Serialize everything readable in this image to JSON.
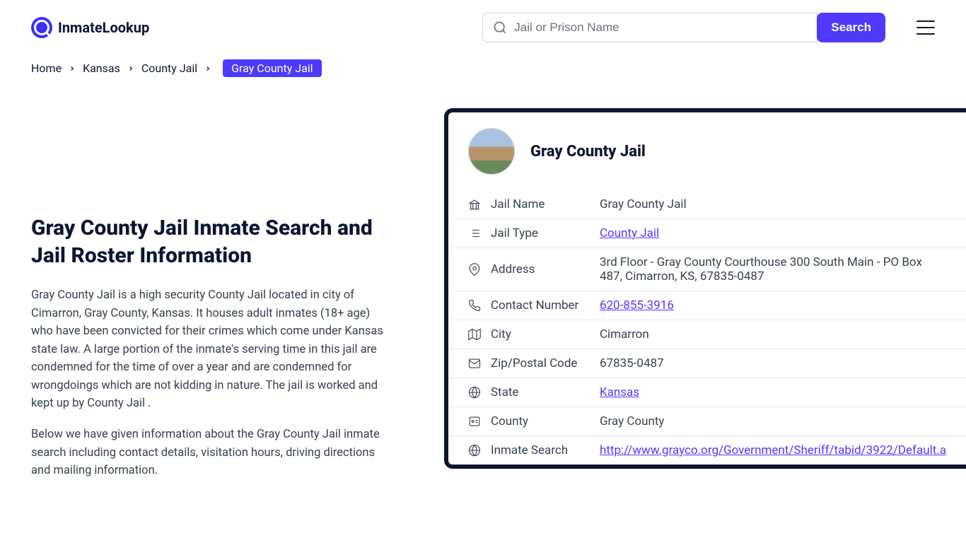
{
  "logo": {
    "text": "InmateLookup"
  },
  "search": {
    "placeholder": "Jail or Prison Name",
    "button": "Search"
  },
  "breadcrumb": {
    "items": [
      "Home",
      "Kansas",
      "County Jail"
    ],
    "current": "Gray County Jail"
  },
  "page": {
    "title": "Gray County Jail Inmate Search and Jail Roster Information",
    "p1": "Gray County Jail is a high security County Jail located in city of Cimarron, Gray County, Kansas. It houses adult inmates (18+ age) who have been convicted for their crimes which come under Kansas state law. A large portion of the inmate's serving time in this jail are condemned for the time of over a year and are condemned for wrongdoings which are not kidding in nature. The jail is worked and kept up by County Jail .",
    "p2": "Below we have given information about the Gray County Jail inmate search including contact details, visitation hours, driving directions and mailing information."
  },
  "card": {
    "title": "Gray County Jail",
    "rows": [
      {
        "icon": "bank",
        "label": "Jail Name",
        "value": "Gray County Jail",
        "link": false
      },
      {
        "icon": "list",
        "label": "Jail Type",
        "value": "County Jail",
        "link": true
      },
      {
        "icon": "pin",
        "label": "Address",
        "value": "3rd Floor - Gray County Courthouse 300 South Main - PO Box 487, Cimarron, KS, 67835-0487",
        "link": false
      },
      {
        "icon": "phone",
        "label": "Contact Number",
        "value": "620-855-3916",
        "link": true
      },
      {
        "icon": "map",
        "label": "City",
        "value": "Cimarron",
        "link": false
      },
      {
        "icon": "mail",
        "label": "Zip/Postal Code",
        "value": "67835-0487",
        "link": false
      },
      {
        "icon": "globe",
        "label": "State",
        "value": "Kansas",
        "link": true
      },
      {
        "icon": "badge",
        "label": "County",
        "value": "Gray County",
        "link": false
      },
      {
        "icon": "web",
        "label": "Inmate Search",
        "value": "http://www.grayco.org/Government/Sheriff/tabid/3922/Default.a",
        "link": true
      }
    ]
  }
}
